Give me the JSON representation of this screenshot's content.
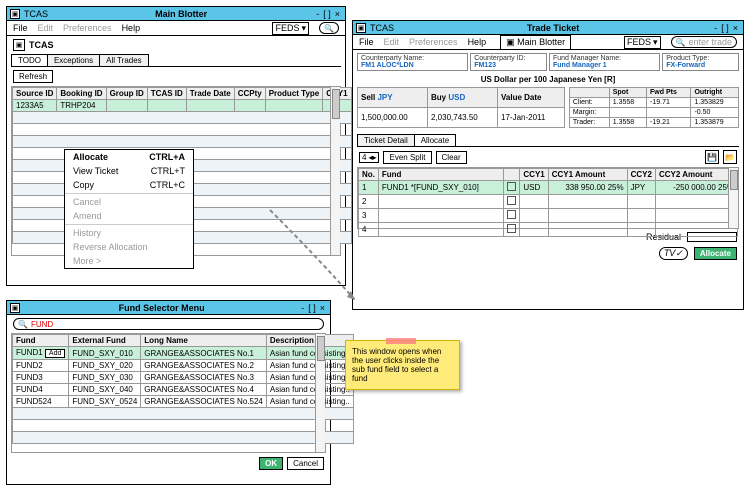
{
  "app": "TCAS",
  "blotter": {
    "title": "Main Blotter",
    "menus": [
      "File",
      "Edit",
      "Preferences",
      "Help"
    ],
    "dropdown": "FEDS",
    "tabs": [
      "TODO",
      "Exceptions",
      "All Trades"
    ],
    "refresh": "Refresh",
    "cols": [
      "Source ID",
      "Booking ID",
      "Group ID",
      "TCAS ID",
      "Trade Date",
      "CCPty",
      "Product Type",
      "CCY1"
    ],
    "row": {
      "source": "1233A5",
      "booking": "TRHP204"
    },
    "ctx": [
      {
        "label": "Allocate",
        "sc": "CTRL+A",
        "bold": true
      },
      {
        "label": "View Ticket",
        "sc": "CTRL+T"
      },
      {
        "label": "Copy",
        "sc": "CTRL+C"
      },
      {
        "label": "Cancel",
        "dim": true
      },
      {
        "label": "Amend",
        "dim": true
      },
      {
        "label": "History",
        "dim": true
      },
      {
        "label": "Reverse Allocation",
        "dim": true
      },
      {
        "label": "More >",
        "dim": true
      }
    ]
  },
  "ticket": {
    "title": "Trade Ticket",
    "menus": [
      "File",
      "Edit",
      "Preferences",
      "Help"
    ],
    "blotter_btn": "Main Blotter",
    "dropdown": "FEDS",
    "search_ph": "enter trade",
    "info": {
      "cp_name_lbl": "Counterparty Name:",
      "cp_name": "FM1 ALOC*LDN",
      "cp_id_lbl": "Counterparty ID:",
      "cp_id": "FM123",
      "fm_lbl": "Fund Manager Name:",
      "fm": "Fund Manager 1",
      "pt_lbl": "Product Type:",
      "pt": "FX-Forward"
    },
    "rate_title": "US Dollar per 100 Japanese Yen  [R]",
    "sell_lbl": "Sell",
    "sell_ccy": "JPY",
    "sell_amt": "1,500,000.00",
    "buy_lbl": "Buy",
    "buy_ccy": "USD",
    "buy_amt": "2,030,743.50",
    "vd_lbl": "Value Date",
    "vd": "17-Jan-2011",
    "rate_cols": [
      "",
      "Spot",
      "Fwd Pts",
      "Outright"
    ],
    "rate_rows": [
      [
        "Client:",
        "1.3558",
        "-19.71",
        "1.353829"
      ],
      [
        "Margin:",
        "",
        "",
        "-0.50"
      ],
      [
        "Trader:",
        "1.3558",
        "-19.21",
        "1.353879"
      ]
    ],
    "tabs": [
      "Ticket Detail",
      "Allocate"
    ],
    "count": "4",
    "even": "Even Split",
    "clear": "Clear",
    "alloc_cols": [
      "No.",
      "Fund",
      "",
      "CCY1",
      "CCY1 Amount",
      "CCY2",
      "CCY2 Amount"
    ],
    "alloc_row": {
      "no": "1",
      "fund": "FUND1 *[FUND_SXY_010]",
      "c1": "USD",
      "a1": "338 950.00 25%",
      "c2": "JPY",
      "a2": "-250 000.00 25%"
    },
    "other_nos": [
      "2",
      "3",
      "4"
    ],
    "residual": "Residual",
    "tv": "TV",
    "allocate": "Allocate"
  },
  "selector": {
    "title": "Fund Selector Menu",
    "search": "FUND",
    "cols": [
      "Fund",
      "External Fund",
      "Long Name",
      "Description"
    ],
    "rows": [
      {
        "f": "FUND1",
        "e": "FUND_SXY_010",
        "l": "GRANGE&ASSOCIATES No.1",
        "d": "Asian fund consisting..",
        "hl": true,
        "add": "Add"
      },
      {
        "f": "FUND2",
        "e": "FUND_SXY_020",
        "l": "GRANGE&ASSOCIATES No.2",
        "d": "Asian fund consisting.."
      },
      {
        "f": "FUND3",
        "e": "FUND_SXY_030",
        "l": "GRANGE&ASSOCIATES No.3",
        "d": "Asian fund consisting.."
      },
      {
        "f": "FUND4",
        "e": "FUND_SXY_040",
        "l": "GRANGE&ASSOCIATES No.4",
        "d": "Asian fund consisting.."
      },
      {
        "f": "FUND524",
        "e": "FUND_SXY_0524",
        "l": "GRANGE&ASSOCIATES No.524",
        "d": "Asian fund consisting.."
      }
    ],
    "ok": "OK",
    "cancel": "Cancel"
  },
  "note": "This window opens when the user clicks inside the sub fund field to select a fund"
}
